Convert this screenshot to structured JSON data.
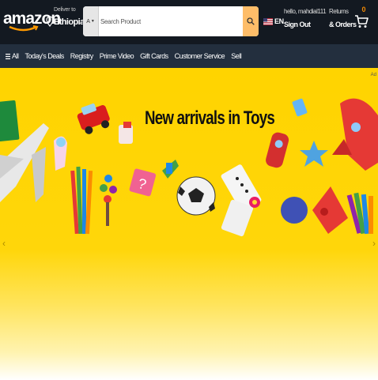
{
  "header": {
    "logo_text": "amazon",
    "deliver": {
      "line1": "Deliver to",
      "line2": "Ethiopia"
    },
    "search": {
      "category_label": "A",
      "placeholder": "Search Product"
    },
    "language": {
      "code": "EN"
    },
    "account": {
      "greeting": "hello, mahdi​al111",
      "action": "Sign Out"
    },
    "returns": {
      "line1": "Returns",
      "line2": "& Orders"
    },
    "cart": {
      "count": "0"
    }
  },
  "nav": {
    "items": [
      "All",
      "Today's Deals",
      "Registry",
      "Prime Video",
      "Gift Cards",
      "Customer Service",
      "Sell"
    ]
  },
  "hero": {
    "title": "New arrivals in Toys",
    "tag": "Ad",
    "prev_icon": "chevron-left-icon",
    "next_icon": "chevron-right-icon"
  },
  "colors": {
    "header_bg": "#131921",
    "nav_bg": "#232f3e",
    "search_button": "#febd69",
    "hero_yellow": "#ffd400",
    "cart_count": "#f08804"
  }
}
